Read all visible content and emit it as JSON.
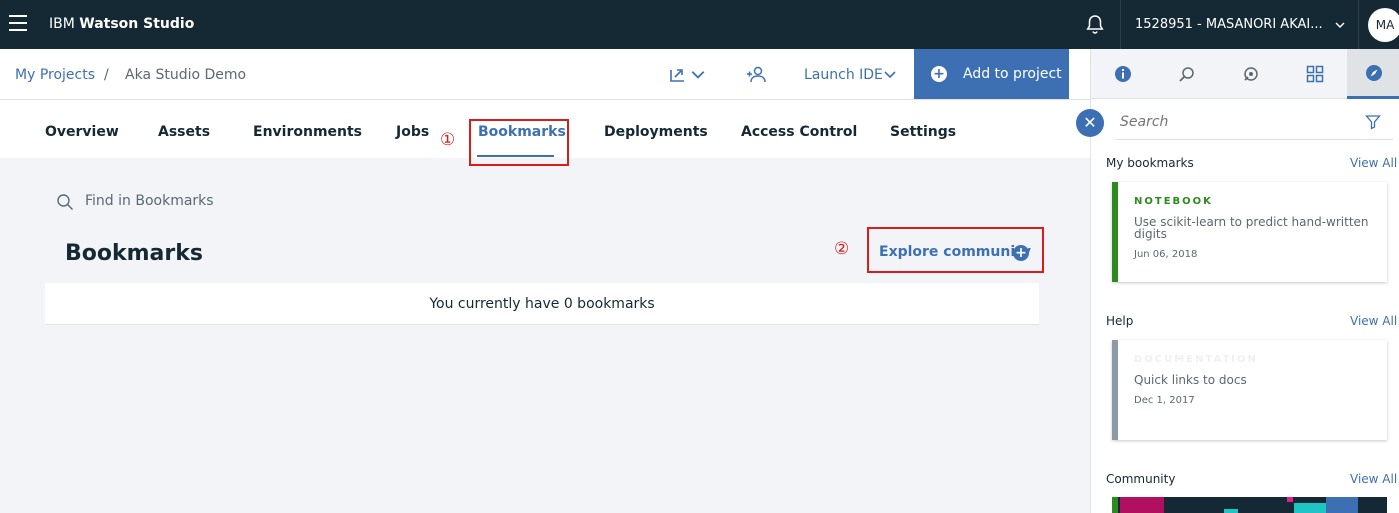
{
  "topbar": {
    "brand_prefix": "IBM",
    "brand_name": "Watson Studio",
    "account_label": "1528951 - MASANORI AKAI...",
    "avatar_initials": "MA"
  },
  "projbar": {
    "breadcrumb_root": "My Projects",
    "breadcrumb_sep": "/",
    "breadcrumb_current": "Aka Studio Demo",
    "launch_ide": "Launch IDE",
    "add_to_project": "Add to project"
  },
  "tabs": [
    "Overview",
    "Assets",
    "Environments",
    "Jobs",
    "Bookmarks",
    "Deployments",
    "Access Control",
    "Settings"
  ],
  "active_tab": "Bookmarks",
  "markers": {
    "one": "①",
    "two": "②"
  },
  "main": {
    "find_placeholder": "Find in Bookmarks",
    "heading": "Bookmarks",
    "explore_label": "Explore community",
    "empty_message": "You currently have 0 bookmarks"
  },
  "right_panel": {
    "search_placeholder": "Search",
    "sections": {
      "bookmarks": {
        "title": "My bookmarks",
        "view_all": "View All"
      },
      "help": {
        "title": "Help",
        "view_all": "View All"
      },
      "community": {
        "title": "Community",
        "view_all": "View All"
      }
    },
    "bookmark_card": {
      "kind": "NOTEBOOK",
      "title": "Use scikit-learn to predict hand-written digits",
      "date": "Jun 06, 2018"
    },
    "help_card": {
      "kind": "DOCUMENTATION",
      "title": "Quick links to docs",
      "date": "Dec 1, 2017"
    }
  },
  "colors": {
    "topbar": "#152935",
    "accent": "#3d70b2",
    "notebook_green": "#2d8a1f",
    "annotation_red": "#d91c1c",
    "doc_gray": "#8c9ba5"
  }
}
